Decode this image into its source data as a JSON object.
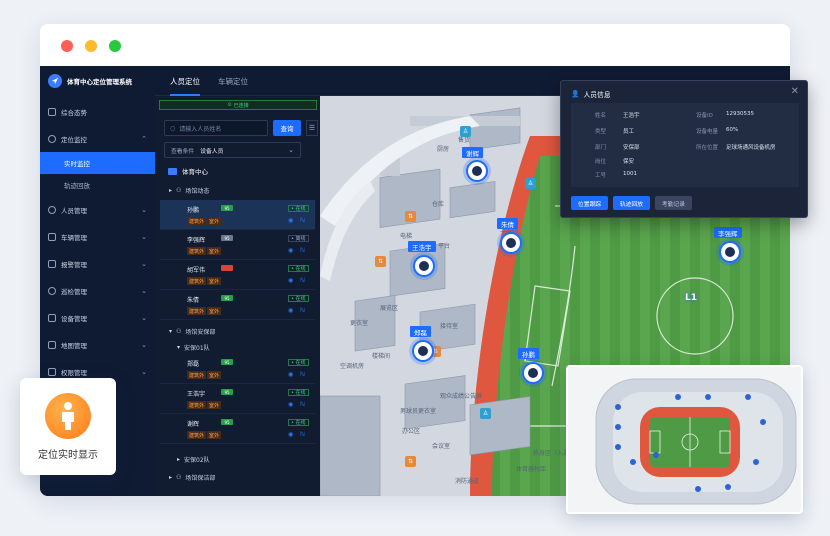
{
  "app": {
    "title": "体育中心定位管理系统"
  },
  "sidebar": {
    "items": [
      {
        "label": "综合态势",
        "icon": "shield-icon"
      },
      {
        "label": "定位监控",
        "icon": "location-icon",
        "expanded": true,
        "children": [
          {
            "label": "实时监控",
            "active": true
          },
          {
            "label": "轨迹回放",
            "active": false
          }
        ]
      },
      {
        "label": "人员管理",
        "icon": "user-icon"
      },
      {
        "label": "车辆管理",
        "icon": "car-icon"
      },
      {
        "label": "报警管理",
        "icon": "alarm-icon"
      },
      {
        "label": "巡检管理",
        "icon": "patrol-icon"
      },
      {
        "label": "设备管理",
        "icon": "device-icon"
      },
      {
        "label": "地图管理",
        "icon": "map-icon"
      },
      {
        "label": "权限管理",
        "icon": "lock-icon"
      }
    ]
  },
  "tabs": [
    {
      "label": "人员定位",
      "active": true
    },
    {
      "label": "车辆定位",
      "active": false
    }
  ],
  "panel": {
    "connection_status": "已连接",
    "search_placeholder": "请输入人员姓名",
    "search_button": "查询",
    "condition_label": "查看条件",
    "condition_value": "设备人员",
    "root": "体育中心",
    "groups": [
      {
        "label": "场馆动态"
      },
      {
        "label": "场馆安保部"
      },
      {
        "label": "安保01队"
      },
      {
        "label": "安保02队"
      },
      {
        "label": "场馆保洁部"
      }
    ],
    "people": [
      {
        "name": "孙鹏",
        "battery": "95",
        "status": "• 在线",
        "tags": [
          "建筑外",
          "室外"
        ],
        "selected": true
      },
      {
        "name": "李强辉",
        "battery": "95",
        "status": "• 离线",
        "tags": [
          "建筑外",
          "室外"
        ],
        "selected": false
      },
      {
        "name": "胡军伟",
        "battery": "",
        "status": "• 在线",
        "tags": [
          "建筑外",
          "室外"
        ],
        "selected": false
      },
      {
        "name": "朱倩",
        "battery": "95",
        "status": "• 在线",
        "tags": [
          "建筑外",
          "室外"
        ],
        "selected": false
      },
      {
        "name": "郑磊",
        "battery": "95",
        "status": "• 在线",
        "tags": [
          "建筑外",
          "室外"
        ],
        "selected": false
      },
      {
        "name": "王浩宇",
        "battery": "95",
        "status": "• 在线",
        "tags": [
          "建筑外",
          "室外"
        ],
        "selected": false
      },
      {
        "name": "谢辉",
        "battery": "95",
        "status": "• 在线",
        "tags": [
          "建筑外",
          "室外"
        ],
        "selected": false
      }
    ]
  },
  "map": {
    "markers": [
      "谢辉",
      "朱倩",
      "王浩宇",
      "郑磊",
      "孙鹏",
      "李强辉"
    ],
    "floor_label": "L1",
    "places": [
      "售货",
      "厨房",
      "仓库",
      "电梯",
      "平台",
      "卫生间",
      "展览区",
      "空调机房",
      "会议室",
      "接待室",
      "更衣室",
      "办公区",
      "男球员更衣室",
      "热身区（入道事库）",
      "体育器材库",
      "观众成绩公告屏",
      "楼梯间",
      "消防通道"
    ]
  },
  "info_card": {
    "title": "人员信息",
    "fields_left": [
      {
        "label": "姓名",
        "value": "王浩宇"
      },
      {
        "label": "类型",
        "value": "员工"
      },
      {
        "label": "部门",
        "value": "安保部"
      },
      {
        "label": "岗位",
        "value": "保安"
      },
      {
        "label": "工号",
        "value": "1001"
      }
    ],
    "fields_right": [
      {
        "label": "设备ID",
        "value": "12930535"
      },
      {
        "label": "设备电量",
        "value": "60%"
      },
      {
        "label": "所在位置",
        "value": "足球场通风设备机房"
      }
    ],
    "buttons": [
      "位置跟踪",
      "轨迹回放",
      "考勤记录"
    ]
  },
  "badge": {
    "text": "定位实时显示"
  },
  "colors": {
    "accent": "#1d6cff",
    "online": "#3fd27a",
    "track": "#e8533f",
    "field": "#3f8f3d",
    "sidebar_bg": "#0f1b33",
    "badge_orange": "#ff8a22"
  }
}
